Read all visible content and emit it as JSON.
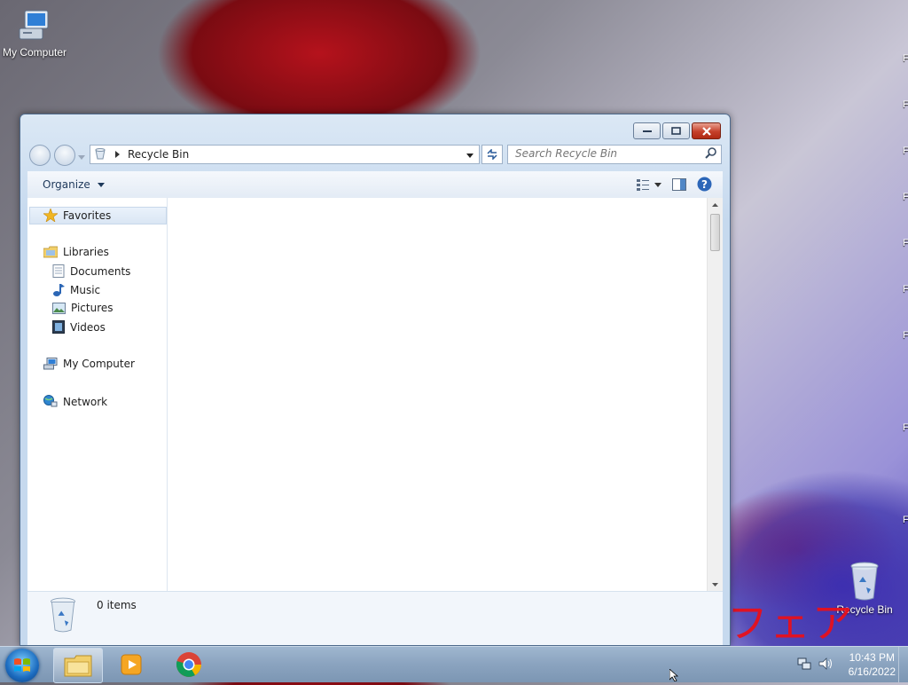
{
  "desktop": {
    "icons": [
      {
        "label": "My Computer",
        "icon": "computer-icon"
      },
      {
        "label": "Recycle Bin",
        "icon": "recycle-bin-icon"
      }
    ],
    "right_edge_glyphs": [
      "F",
      "F",
      "F",
      "F",
      "F",
      "F",
      "F",
      "F",
      "F"
    ],
    "overlay_text": "フェア"
  },
  "window": {
    "title_buttons": {
      "minimize": "minimize",
      "maximize": "maximize",
      "close": "close"
    },
    "address": {
      "location": "Recycle Bin"
    },
    "search": {
      "placeholder": "Search Recycle Bin"
    },
    "toolbar": {
      "organize_label": "Organize"
    },
    "nav_pane": {
      "favorites": "Favorites",
      "libraries": "Libraries",
      "library_items": [
        "Documents",
        "Music",
        "Pictures",
        "Videos"
      ],
      "computer": "My Computer",
      "network": "Network"
    },
    "status": {
      "item_count": "0 items"
    }
  },
  "taskbar": {
    "apps": [
      "Windows Explorer",
      "Windows Media Player",
      "Google Chrome"
    ],
    "clock": {
      "time": "10:43 PM",
      "date": "6/16/2022"
    }
  },
  "colors": {
    "accent": "#1e395b",
    "close_red": "#c5402a",
    "taskbar": "#8aa3bf"
  }
}
